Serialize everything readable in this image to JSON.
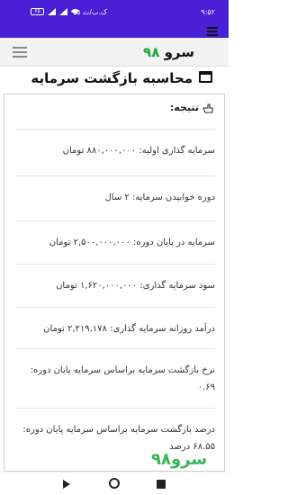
{
  "status_bar": {
    "time": "۹:۵۲",
    "battery": "۶۵",
    "center": "۰.۵ ک.ب/ث"
  },
  "header": {
    "logo_text": "سرو",
    "logo_num": "۹۸"
  },
  "page": {
    "title": "محاسبه بازگشت سرمایه",
    "result_label": "نتیجه:"
  },
  "results": [
    "سرمایه گذاری اولیه: ۸۸۰,۰۰۰,۰۰۰ تومان",
    "دوره خوابیدن سرمایه: ۲ سال",
    "سرمایه در پایان دوره: ۲,۵۰۰,۰۰۰,۰۰۰ تومان",
    "سود سرمایه گذاری: ۱,۶۲۰,۰۰۰,۰۰۰ تومان",
    "درآمد روزانه سرمایه گذاری: ۲,۲۱۹,۱۷۸ تومان",
    "نرخ بازگشت سرمایه براساس سرمایه پایان دوره: ۰.۶۹",
    "درصد بازگشت سرمایه براساس سرمایه پایان دوره: ۶۸.۵۵ درصد"
  ],
  "watermark": "سرو۹۸",
  "colors": {
    "status_bar": "#4a1fd6",
    "logo_accent": "#18a83a"
  },
  "icons": {
    "result": "hand-pointer-icon",
    "title": "window-icon"
  }
}
